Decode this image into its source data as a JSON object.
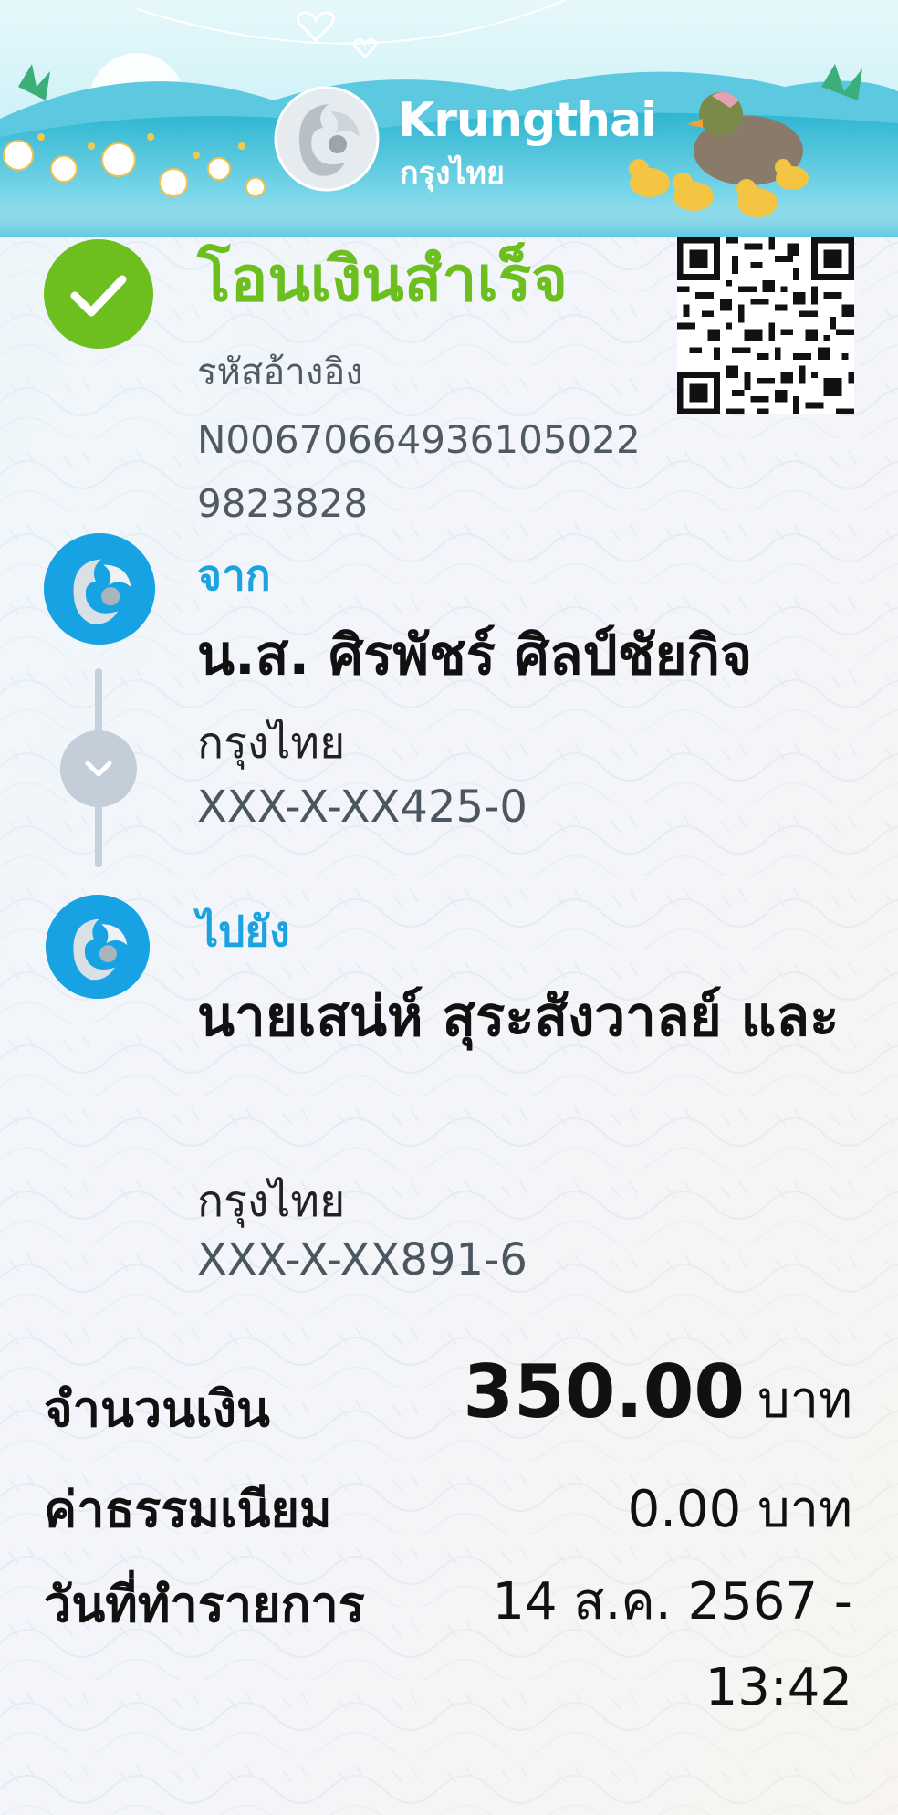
{
  "brand": {
    "name_en": "Krungthai",
    "name_th": "กรุงไทย"
  },
  "status": {
    "title": "โอนเงินสำเร็จ",
    "ref_label": "รหัสอ้างอิง",
    "ref_value": "N006706649361050229823828"
  },
  "from": {
    "label": "จาก",
    "name": "น.ส. ศิรพัชร์  ศิลป์ชัยกิจ",
    "bank": "กรุงไทย",
    "account": "XXX-X-XX425-0"
  },
  "to": {
    "label": "ไปยัง",
    "name": "นายเสน่ห์ สุระสังวาลย์ และ",
    "bank": "กรุงไทย",
    "account": "XXX-X-XX891-6"
  },
  "summary": {
    "amount_label": "จำนวนเงิน",
    "amount_value": "350.00",
    "amount_unit": "บาท",
    "fee_label": "ค่าธรรมเนียม",
    "fee_value": "0.00 บาท",
    "date_label": "วันที่ทำรายการ",
    "date_value": "14 ส.ค. 2567 - 13:42"
  },
  "colors": {
    "success": "#6cbf1f",
    "accent": "#1aa3e0",
    "node": "#c3ced9"
  },
  "icons": [
    "check-icon",
    "qr-code-icon",
    "bank-logo-icon",
    "chevron-down-icon"
  ]
}
